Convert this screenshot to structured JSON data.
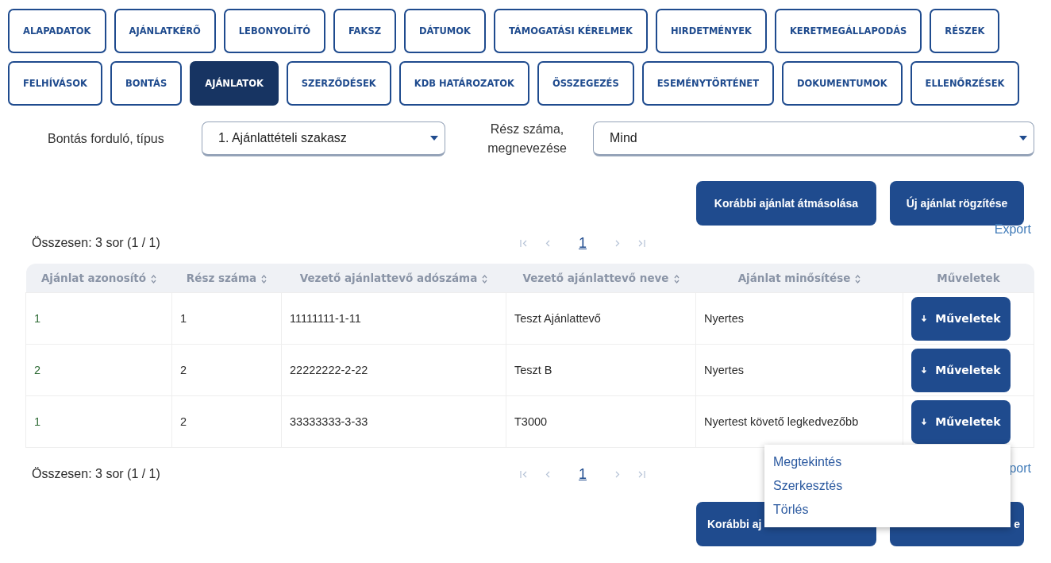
{
  "tab_rows": [
    [
      {
        "label": "ALAPADATOK",
        "selected": false
      },
      {
        "label": "AJÁNLATKÉRŐ",
        "selected": false
      },
      {
        "label": "LEBONYOLÍTÓ",
        "selected": false
      },
      {
        "label": "FAKSZ",
        "selected": false
      },
      {
        "label": "DÁTUMOK",
        "selected": false
      },
      {
        "label": "TÁMOGATÁSI KÉRELMEK",
        "selected": false
      },
      {
        "label": "HIRDETMÉNYEK",
        "selected": false
      },
      {
        "label": "KERETMEGÁLLAPODÁS",
        "selected": false
      },
      {
        "label": "RÉSZEK",
        "selected": false
      }
    ],
    [
      {
        "label": "FELHÍVÁSOK",
        "selected": false
      },
      {
        "label": "BONTÁS",
        "selected": false
      },
      {
        "label": "AJÁNLATOK",
        "selected": true
      },
      {
        "label": "SZERZŐDÉSEK",
        "selected": false
      },
      {
        "label": "KDB HATÁROZATOK",
        "selected": false
      },
      {
        "label": "ÖSSZEGEZÉS",
        "selected": false
      },
      {
        "label": "ESEMÉNYTÖRTÉNET",
        "selected": false
      },
      {
        "label": "DOKUMENTUMOK",
        "selected": false
      },
      {
        "label": "ELLENŐRZÉSEK",
        "selected": false
      }
    ]
  ],
  "filters": [
    {
      "label": "Bontás forduló, típus",
      "value": "1. Ajánlattételi szakasz"
    },
    {
      "label": "Rész száma, megnevezése",
      "value": "Mind"
    }
  ],
  "top_buttons": [
    "Korábbi ajánlat átmásolása",
    "Új ajánlat rögzítése"
  ],
  "top_pager": {
    "summary": "Összesen: 3 sor (1 / 1)",
    "page": "1",
    "export": "Export"
  },
  "table": {
    "columns": [
      {
        "label": "Ajánlat azonosító",
        "sortable": true
      },
      {
        "label": "Rész száma",
        "sortable": true
      },
      {
        "label": "Vezető ajánlattevő adószáma",
        "sortable": true
      },
      {
        "label": "Vezető ajánlattevő neve",
        "sortable": true
      },
      {
        "label": "Ajánlat minősítése",
        "sortable": true
      },
      {
        "label": "Műveletek",
        "sortable": false
      }
    ],
    "rows": [
      {
        "cells": [
          "1",
          "1",
          "11111111-1-11",
          "Teszt Ajánlattevő",
          "Nyertes"
        ],
        "action": "Műveletek"
      },
      {
        "cells": [
          "2",
          "2",
          "22222222-2-22",
          "Teszt B",
          "Nyertes"
        ],
        "action": "Műveletek"
      },
      {
        "cells": [
          "1",
          "2",
          "33333333-3-33",
          "T3000",
          "Nyertest követő legkedvezőbb"
        ],
        "action": "Műveletek",
        "menu": {
          "items": [
            "Megtekintés",
            "Szerkesztés",
            "Törlés"
          ]
        }
      }
    ]
  },
  "bottom_pager": {
    "summary": "Összesen: 3 sor (1 / 1)",
    "page": "1",
    "export": "port"
  },
  "bottom_buttons": [
    "Korábbi aj",
    "e"
  ]
}
